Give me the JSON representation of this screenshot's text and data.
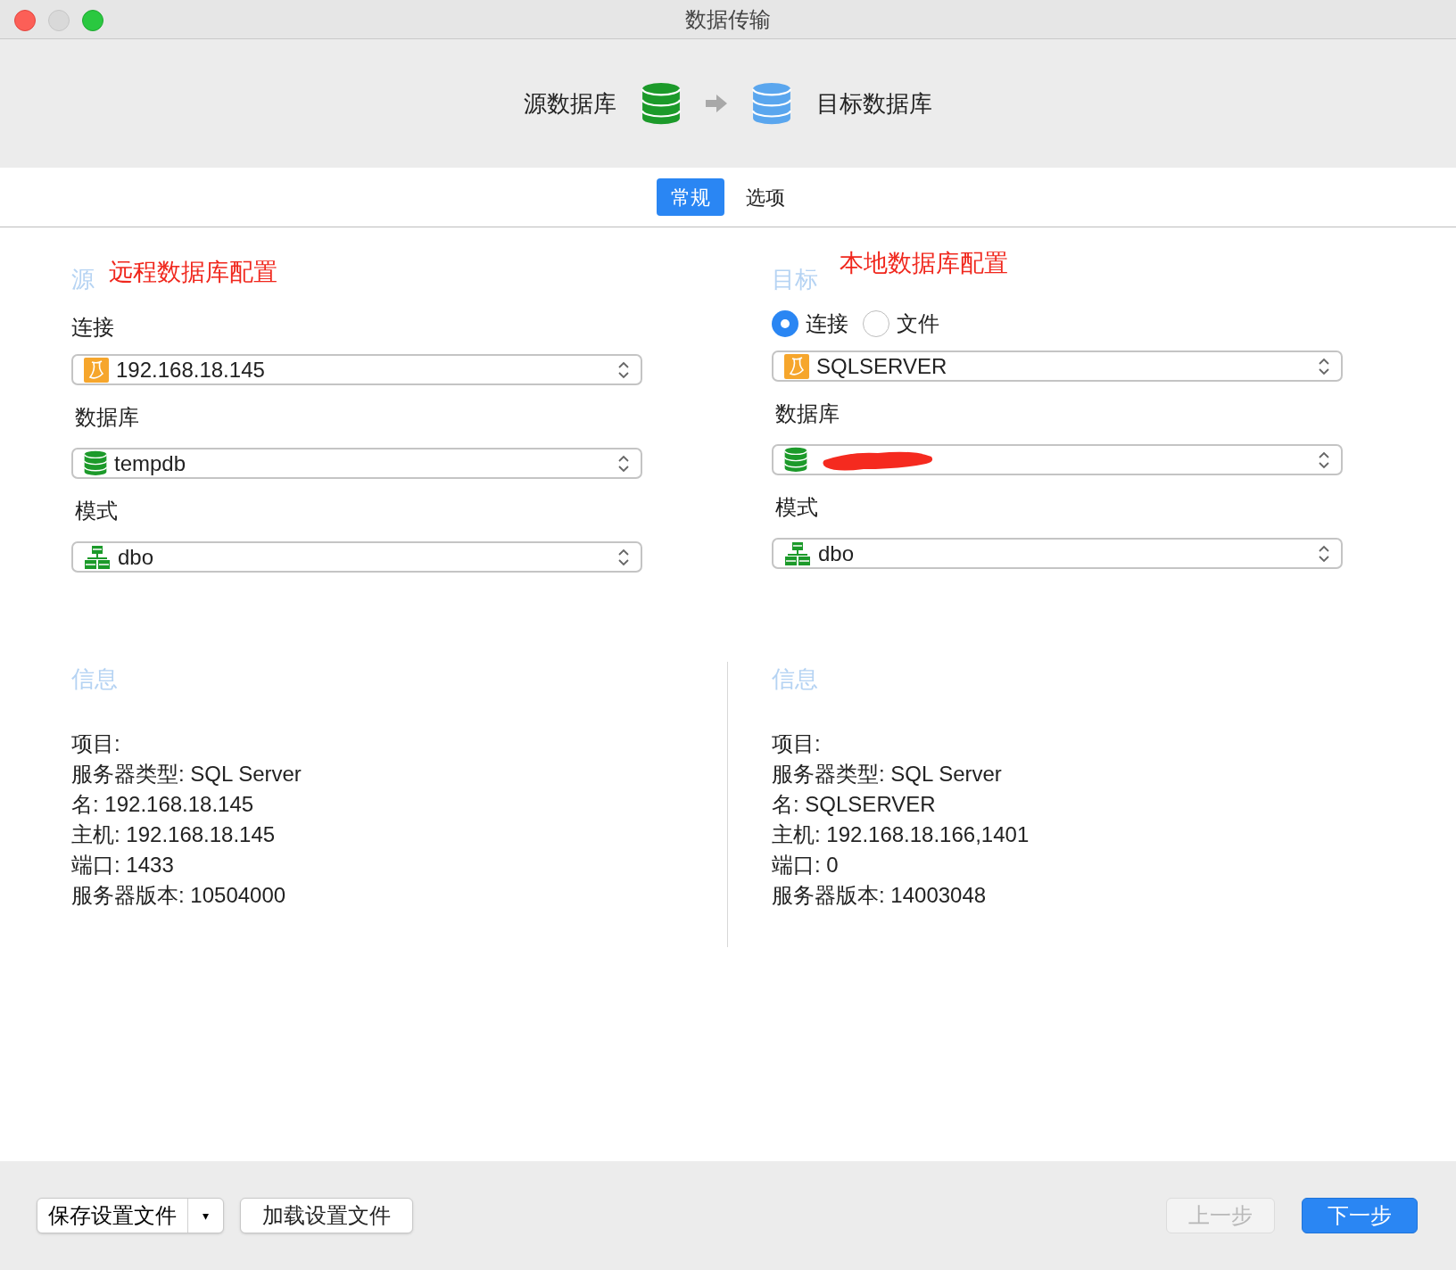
{
  "window": {
    "title": "数据传输"
  },
  "header": {
    "source_label": "源数据库",
    "target_label": "目标数据库"
  },
  "tabs": [
    {
      "label": "常规",
      "selected": true
    },
    {
      "label": "选项",
      "selected": false
    }
  ],
  "source": {
    "heading": "源",
    "annotation": "远程数据库配置",
    "connection_label": "连接",
    "fields": [
      {
        "kind": "server",
        "value": "192.168.18.145",
        "redacted": false
      },
      {
        "kind": "label",
        "value": "数据库"
      },
      {
        "kind": "database",
        "value": "tempdb",
        "redacted": false
      },
      {
        "kind": "label",
        "value": "模式"
      },
      {
        "kind": "schema",
        "value": "dbo",
        "redacted": false
      }
    ]
  },
  "target": {
    "heading": "目标",
    "annotation": "本地数据库配置",
    "modes": [
      {
        "label": "连接",
        "selected": true
      },
      {
        "label": "文件",
        "selected": false
      }
    ],
    "fields": [
      {
        "kind": "server",
        "value": "SQLSERVER",
        "redacted": false
      },
      {
        "kind": "label",
        "value": "数据库"
      },
      {
        "kind": "database",
        "redacted": true
      },
      {
        "kind": "label",
        "value": "模式"
      },
      {
        "kind": "schema",
        "value": "dbo",
        "redacted": false
      }
    ]
  },
  "info": [
    {
      "heading": "信息",
      "lines": [
        "项目:",
        "服务器类型: SQL Server",
        "名: 192.168.18.145",
        "主机: 192.168.18.145",
        "端口: 1433",
        "服务器版本: 10504000"
      ]
    },
    {
      "heading": "信息",
      "lines": [
        "项目:",
        "服务器类型: SQL Server",
        "名: SQLSERVER",
        "主机: 192.168.18.166,1401",
        "端口: 0",
        "服务器版本: 14003048"
      ]
    }
  ],
  "footer": {
    "left": [
      {
        "label": "保存设置文件",
        "kind": "split",
        "menu": "▾"
      },
      {
        "label": "加载设置文件",
        "kind": "plain"
      }
    ],
    "right": [
      {
        "label": "上一步",
        "kind": "plain",
        "disabled": true
      },
      {
        "label": "下一步",
        "kind": "primary",
        "disabled": false
      }
    ]
  }
}
